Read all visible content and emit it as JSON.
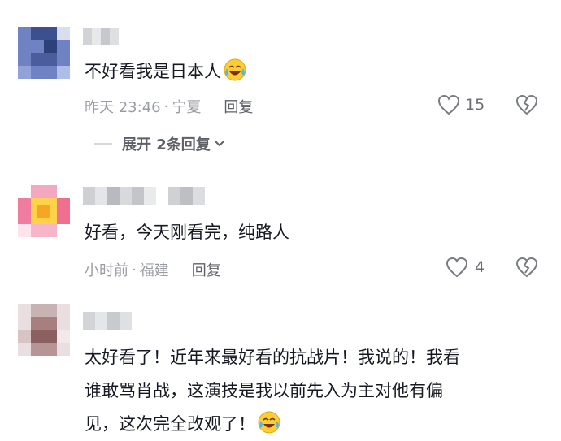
{
  "comments": [
    {
      "text": "不好看我是日本人",
      "emoji": "crying-laughing-emoji",
      "time": "昨天 23:46",
      "location": "宁夏",
      "reply_label": "回复",
      "likes": "15",
      "expand_label": "展开 2条回复"
    },
    {
      "text": "好看，今天刚看完，纯路人",
      "time": "小时前",
      "location": "福建",
      "reply_label": "回复",
      "likes": "4"
    },
    {
      "text_lines": [
        "太好看了！近年来最好看的抗战片！我说的！我看",
        "谁敢骂肖战，这演技是我以前先入为主对他有偏",
        "见，这次完全改观了！"
      ],
      "emoji": "crying-laughing-emoji"
    }
  ],
  "icons": {
    "like": "heart-outline-icon",
    "dislike": "broken-heart-icon",
    "expand": "chevron-down-icon"
  },
  "colors": {
    "text": "#161823",
    "meta": "#9a9ca3",
    "reply": "#5e6068",
    "emoji_face": "#ffcc33"
  }
}
